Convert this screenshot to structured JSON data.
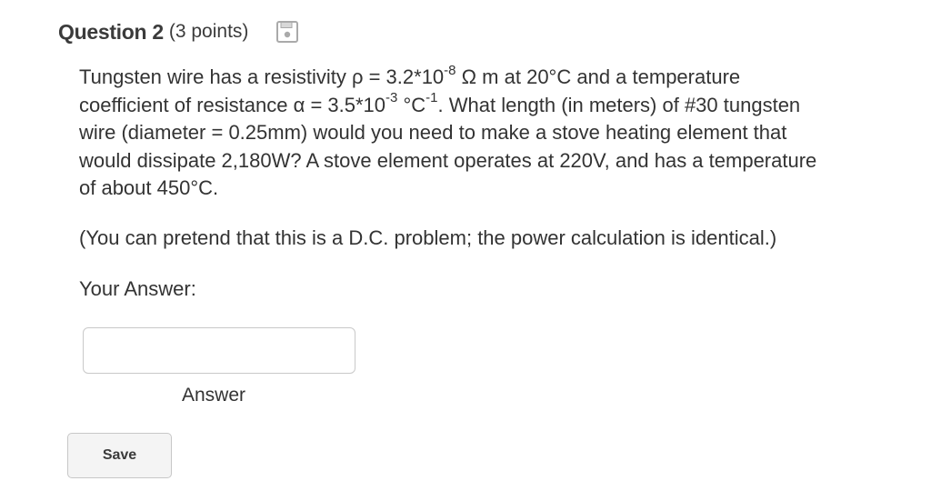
{
  "question": {
    "title": "Question 2",
    "points": "(3 points)",
    "status_icon": "floppy-disk-save-status-icon",
    "body": {
      "line1_a": "Tungsten wire has a resistivity ρ = 3.2*10",
      "line1_exp": "-8",
      "line1_b": " Ω m at 20°C and a temperature",
      "line2_a": "coefficient of resistance α = 3.5*10",
      "line2_exp1": "-3",
      "line2_b": " °C",
      "line2_exp2": "-1",
      "line2_c": ". What length (in meters) of #30 tungsten",
      "line3": "wire (diameter = 0.25mm) would you need to make a stove heating element that",
      "line4": "would dissipate 2,180W? A stove element operates at 220V, and has a temperature",
      "line5": "of about 450°C."
    },
    "note": "(You can pretend that this is a D.C. problem; the power calculation is identical.)"
  },
  "answer": {
    "label": "Your Answer:",
    "value": "",
    "caption": "Answer"
  },
  "actions": {
    "save_label": "Save"
  },
  "colors": {
    "text": "#333333",
    "input_border": "#c9c9c9",
    "button_bg": "#f4f4f4",
    "icon": "#aaaaaa"
  }
}
